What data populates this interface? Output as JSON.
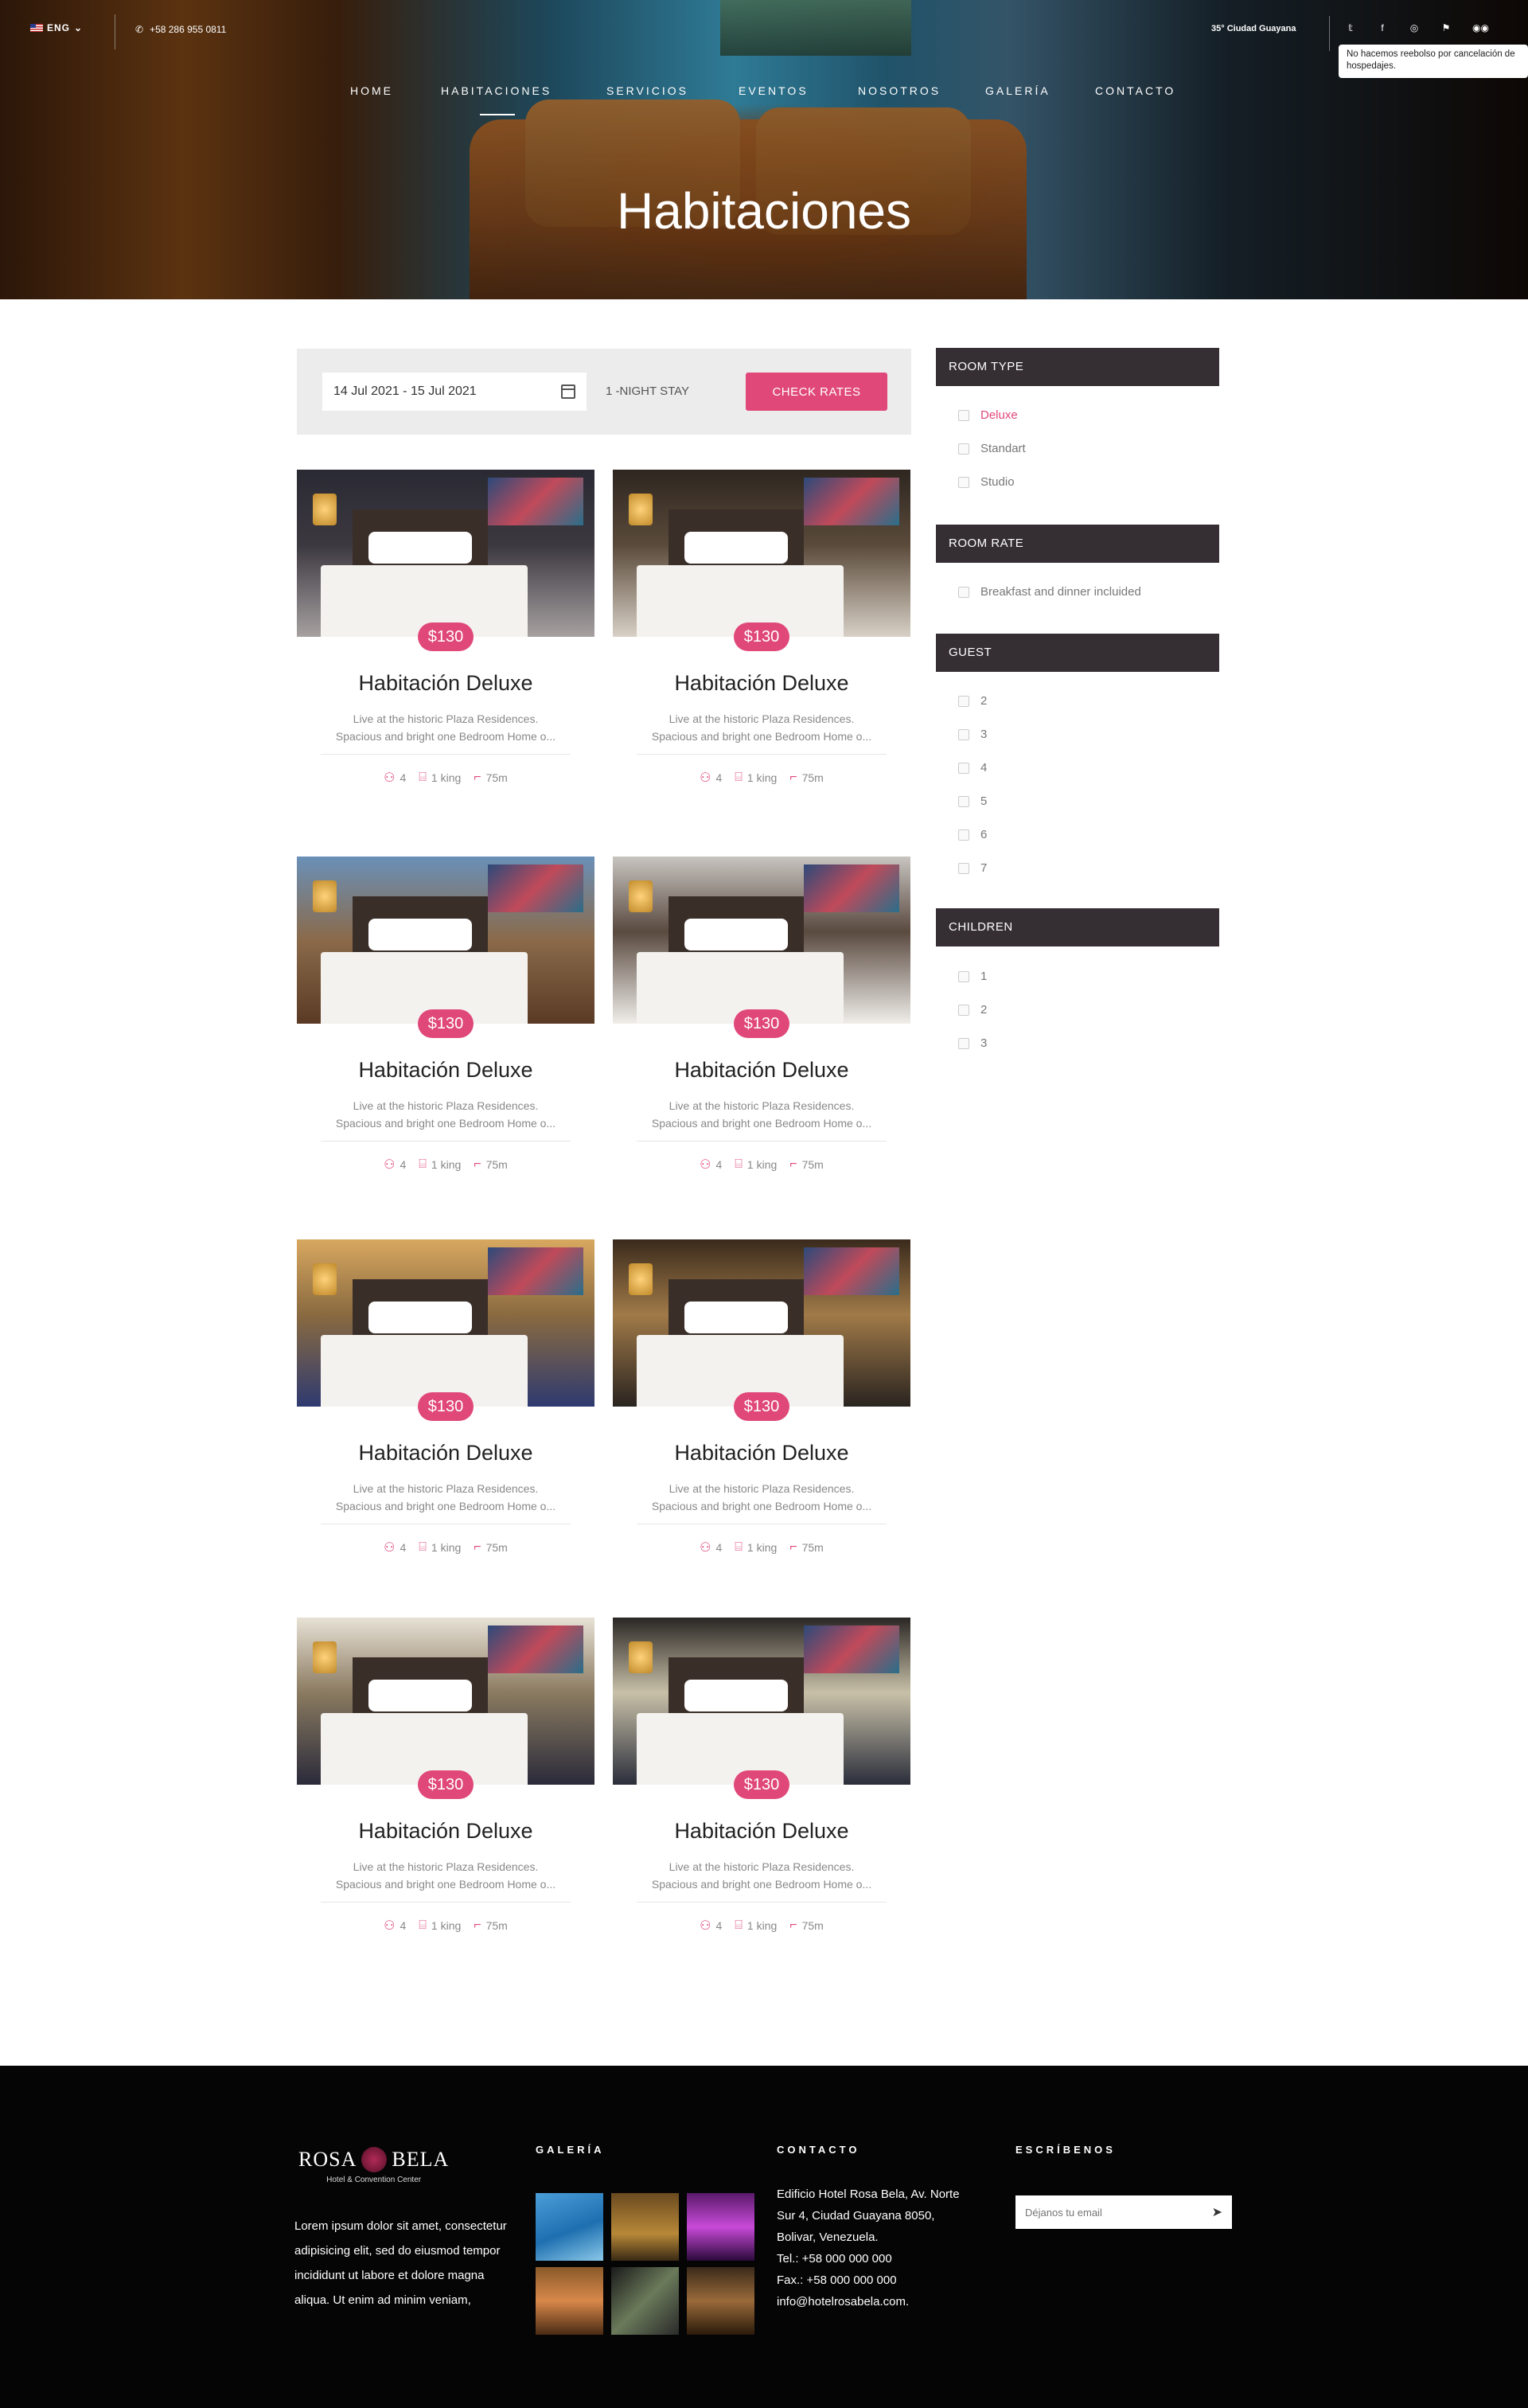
{
  "topbar": {
    "lang": "ENG",
    "phone": "+58 286 955 0811",
    "weather": "35° Ciudad Guayana",
    "notice": "No hacemos reebolso por cancelación de hospedajes."
  },
  "nav": {
    "items": [
      "HOME",
      "HABITACIONES",
      "SERVICIOS",
      "EVENTOS",
      "NOSOTROS",
      "GALERÍA",
      "CONTACTO"
    ],
    "active": "HABITACIONES"
  },
  "hero": {
    "title": "Habitaciones"
  },
  "booking": {
    "dates": "14 Jul 2021 - 15 Jul 2021",
    "stay": "1 -NIGHT STAY",
    "button": "CHECK RATES"
  },
  "rooms": [
    {
      "price": "$130",
      "title": "Habitación Deluxe",
      "desc1": "Live at the historic Plaza Residences.",
      "desc2": "Spacious and bright one Bedroom Home o...",
      "guests": "4",
      "bed": "1 king",
      "size": "75m"
    },
    {
      "price": "$130",
      "title": "Habitación Deluxe",
      "desc1": "Live at the historic Plaza Residences.",
      "desc2": "Spacious and bright one Bedroom Home o...",
      "guests": "4",
      "bed": "1 king",
      "size": "75m"
    },
    {
      "price": "$130",
      "title": "Habitación Deluxe",
      "desc1": "Live at the historic Plaza Residences.",
      "desc2": "Spacious and bright one Bedroom Home o...",
      "guests": "4",
      "bed": "1 king",
      "size": "75m"
    },
    {
      "price": "$130",
      "title": "Habitación Deluxe",
      "desc1": "Live at the historic Plaza Residences.",
      "desc2": "Spacious and bright one Bedroom Home o...",
      "guests": "4",
      "bed": "1 king",
      "size": "75m"
    },
    {
      "price": "$130",
      "title": "Habitación Deluxe",
      "desc1": "Live at the historic Plaza Residences.",
      "desc2": "Spacious and bright one Bedroom Home o...",
      "guests": "4",
      "bed": "1 king",
      "size": "75m"
    },
    {
      "price": "$130",
      "title": "Habitación Deluxe",
      "desc1": "Live at the historic Plaza Residences.",
      "desc2": "Spacious and bright one Bedroom Home o...",
      "guests": "4",
      "bed": "1 king",
      "size": "75m"
    },
    {
      "price": "$130",
      "title": "Habitación Deluxe",
      "desc1": "Live at the historic Plaza Residences.",
      "desc2": "Spacious and bright one Bedroom Home o...",
      "guests": "4",
      "bed": "1 king",
      "size": "75m"
    },
    {
      "price": "$130",
      "title": "Habitación Deluxe",
      "desc1": "Live at the historic Plaza Residences.",
      "desc2": "Spacious and bright one Bedroom Home o...",
      "guests": "4",
      "bed": "1 king",
      "size": "75m"
    }
  ],
  "filters": {
    "room_type": {
      "title": "ROOM TYPE",
      "options": [
        "Deluxe",
        "Standart",
        "Studio"
      ]
    },
    "room_rate": {
      "title": "ROOM RATE",
      "options": [
        "Breakfast and dinner incluided"
      ]
    },
    "guest": {
      "title": "GUEST",
      "options": [
        "2",
        "3",
        "4",
        "5",
        "6",
        "7"
      ]
    },
    "children": {
      "title": "CHILDREN",
      "options": [
        "1",
        "2",
        "3"
      ]
    }
  },
  "footer": {
    "logo_name_1": "ROSA",
    "logo_name_2": "BELA",
    "logo_sub": "Hotel & Convention Center",
    "about": "Lorem ipsum dolor sit amet, consectetur adipisicing elit, sed do eiusmod tempor incididunt ut labore et dolore magna aliqua. Ut enim ad minim veniam,",
    "gallery_title": "GALERÍA",
    "contact_title": "CONTACTO",
    "contact_lines": [
      "Edificio Hotel Rosa Bela, Av. Norte",
      "Sur 4, Ciudad Guayana 8050,",
      "Bolivar, Venezuela.",
      "Tel.: +58 000 000 000",
      "Fax.: +58 000 000 000",
      "info@hotelrosabela.com."
    ],
    "subscribe_title": "ESCRÍBENOS",
    "email_placeholder": "Déjanos tu email"
  },
  "colors": {
    "accent": "#e0487a",
    "sidebar_head": "#352e33",
    "footer_bg": "#050505"
  }
}
